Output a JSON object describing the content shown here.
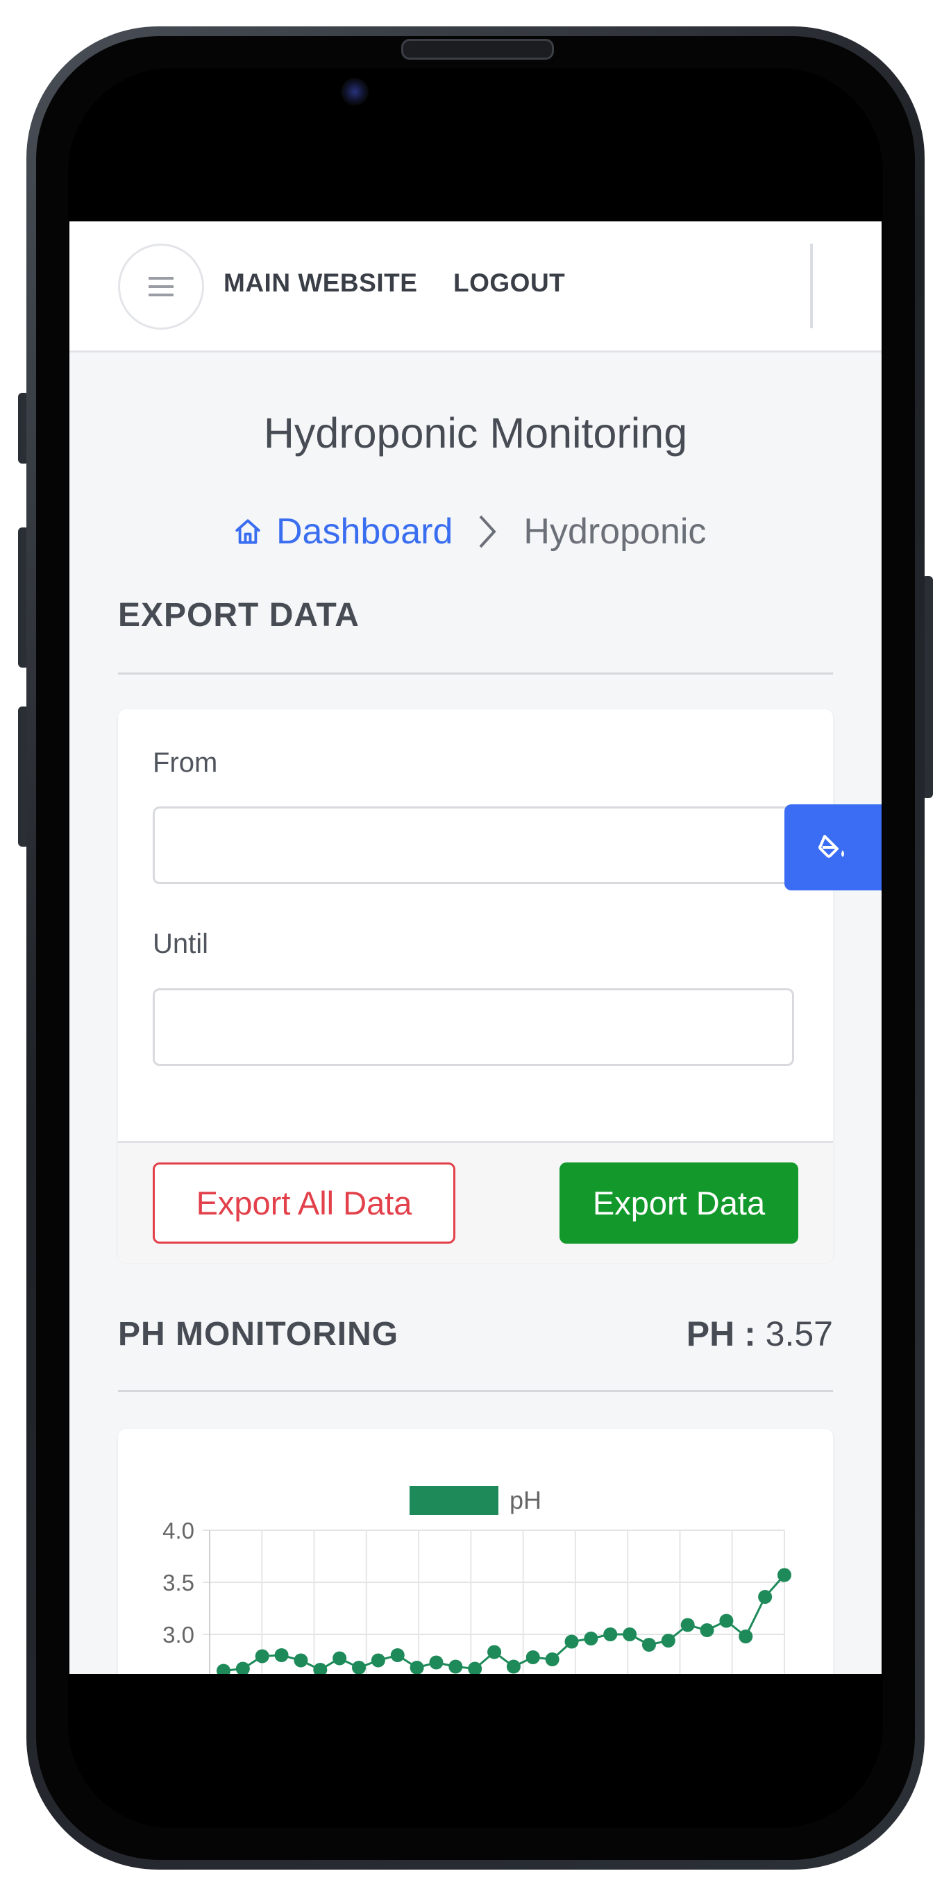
{
  "nav": {
    "main_website": "MAIN WEBSITE",
    "logout": "LOGOUT"
  },
  "page": {
    "title": "Hydroponic Monitoring"
  },
  "breadcrumb": {
    "home": "Dashboard",
    "current": "Hydroponic"
  },
  "export": {
    "section_title": "EXPORT DATA",
    "from_label": "From",
    "from_value": "",
    "until_label": "Until",
    "until_value": "",
    "export_all_label": "Export All Data",
    "export_label": "Export Data"
  },
  "ph": {
    "section_title": "PH MONITORING",
    "readout_label": "PH :",
    "readout_value": "3.57"
  },
  "colors": {
    "accent_blue": "#3a6ef0",
    "danger_red": "#e2404a",
    "success_green": "#13992b",
    "series_green": "#1e8a5a"
  },
  "icons": {
    "menu": "hamburger-icon",
    "home": "home-icon",
    "separator": "chevron-right-icon",
    "theme": "paint-bucket-icon"
  },
  "chart_data": {
    "type": "line",
    "legend": [
      "pH"
    ],
    "y_ticks": [
      "4.0",
      "3.5",
      "3.0"
    ],
    "ylim": [
      2.5,
      4.0
    ],
    "grid": true,
    "legend_position": "top",
    "series": [
      {
        "name": "pH",
        "values": [
          2.65,
          2.67,
          2.79,
          2.8,
          2.75,
          2.66,
          2.77,
          2.68,
          2.75,
          2.8,
          2.68,
          2.73,
          2.69,
          2.67,
          2.83,
          2.69,
          2.78,
          2.76,
          2.93,
          2.96,
          3.0,
          3.0,
          2.9,
          2.94,
          3.09,
          3.04,
          3.13,
          2.98,
          3.36,
          3.57
        ]
      }
    ]
  }
}
